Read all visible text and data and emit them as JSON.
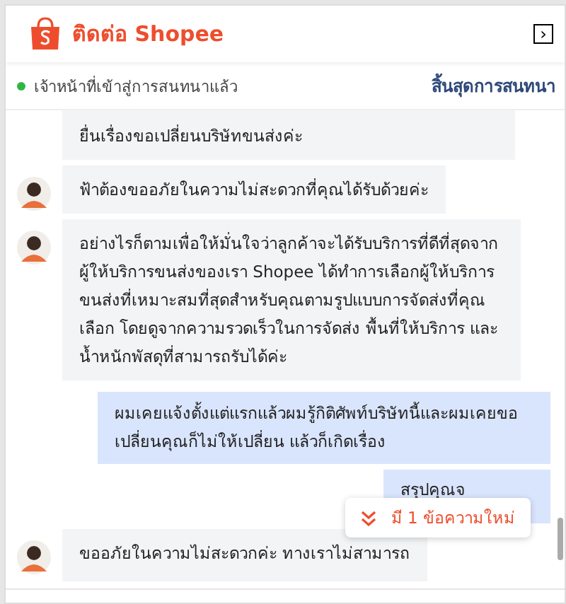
{
  "header": {
    "title": "ติดต่อ Shopee",
    "collapse_icon": "›"
  },
  "agent_status": {
    "online": true,
    "text": "เจ้าหน้าที่เข้าสู่การสนทนาแล้ว",
    "end_link": "สิ้นสุดการสนทนา"
  },
  "messages": [
    {
      "kind": "agent",
      "avatar": false,
      "text": "ยื่นเรื่องขอเปลี่ยนบริษัทขนส่งค่ะ"
    },
    {
      "kind": "agent",
      "avatar": true,
      "text": "ฟ้าต้องขออภัยในความไม่สะดวกที่คุณได้รับด้วยค่ะ"
    },
    {
      "kind": "agent",
      "avatar": true,
      "text": "อย่างไรก็ตามเพื่อให้มั่นใจว่าลูกค้าจะได้รับบริการที่ดีที่สุดจากผู้ให้บริการขนส่งของเรา Shopee ได้ทำการเลือกผู้ให้บริการขนส่งที่เหมาะสมที่สุดสำหรับคุณตามรูปแบบการจัดส่งที่คุณเลือก โดยดูจากความรวดเร็วในการจัดส่ง พื้นที่ให้บริการ และน้ำหนักพัสดุที่สามารถรับได้ค่ะ"
    },
    {
      "kind": "user",
      "avatar": false,
      "text": "ผมเคยแจ้งตั้งแต่แรกแล้วผมรู้กิติศัพท์บริษัทนี้และผมเคยขอเปลี่ยนคุณก็ไม่ให้เปลี่ยน แล้วก็เกิดเรื่อง"
    },
    {
      "kind": "user",
      "avatar": false,
      "text": "สรุปคุณจ"
    },
    {
      "kind": "agent",
      "avatar": true,
      "text": "ขออภัยในความไม่สะดวกค่ะ ทางเราไม่สามารถ"
    }
  ],
  "new_message_toast": "มี 1 ข้อความใหม่"
}
